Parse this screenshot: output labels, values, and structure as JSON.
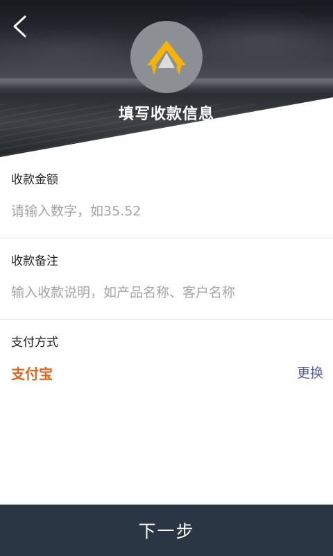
{
  "header": {
    "title": "填写收款信息",
    "back_icon": "chevron-left-icon",
    "logo_icon": "crown-arrow-logo-icon",
    "colors": {
      "logo_yellow": "#f5b400",
      "logo_circle": "#8c8f93"
    }
  },
  "form": {
    "amount": {
      "label": "收款金额",
      "placeholder": "请输入数字，如35.52",
      "value": ""
    },
    "note": {
      "label": "收款备注",
      "placeholder": "输入收款说明，如产品名称、客户名称",
      "value": ""
    },
    "payment": {
      "label": "支付方式",
      "method": "支付宝",
      "change_label": "更换",
      "method_color": "#e0641d"
    }
  },
  "footer": {
    "next_label": "下一步",
    "bg_color": "#2a3644"
  }
}
